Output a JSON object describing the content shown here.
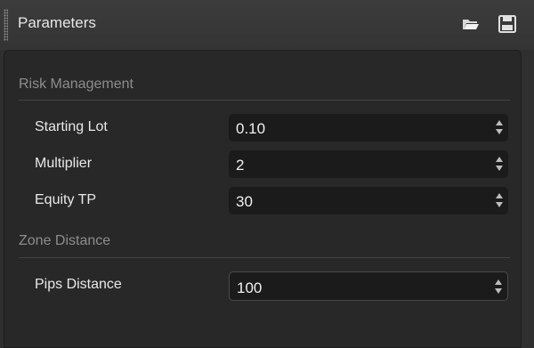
{
  "panel": {
    "title": "Parameters",
    "icons": {
      "open": "folder-open-icon",
      "save": "save-icon"
    }
  },
  "sections": [
    {
      "title": "Risk Management",
      "params": [
        {
          "label": "Starting Lot",
          "value": "0.10"
        },
        {
          "label": "Multiplier",
          "value": "2"
        },
        {
          "label": "Equity TP",
          "value": "30"
        }
      ]
    },
    {
      "title": "Zone Distance",
      "params": [
        {
          "label": "Pips Distance",
          "value": "100"
        }
      ]
    }
  ],
  "colors": {
    "background": "#2f2f2f",
    "input_background": "#1b1b1b",
    "text": "#e8e8e8",
    "section_text": "#8d8d8d"
  }
}
